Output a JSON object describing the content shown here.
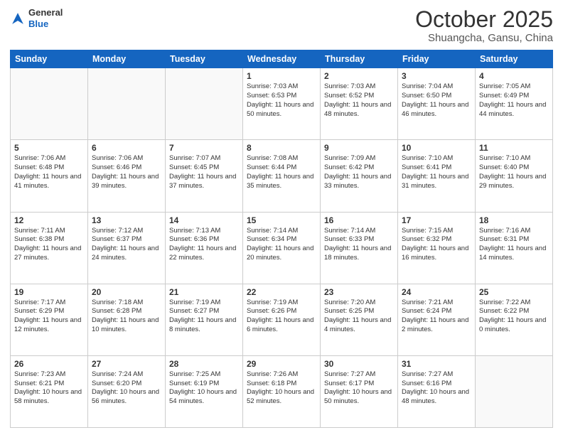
{
  "logo": {
    "line1": "General",
    "line2": "Blue"
  },
  "header": {
    "month": "October 2025",
    "location": "Shuangcha, Gansu, China"
  },
  "weekdays": [
    "Sunday",
    "Monday",
    "Tuesday",
    "Wednesday",
    "Thursday",
    "Friday",
    "Saturday"
  ],
  "weeks": [
    [
      {
        "day": "",
        "info": ""
      },
      {
        "day": "",
        "info": ""
      },
      {
        "day": "",
        "info": ""
      },
      {
        "day": "1",
        "info": "Sunrise: 7:03 AM\nSunset: 6:53 PM\nDaylight: 11 hours and 50 minutes."
      },
      {
        "day": "2",
        "info": "Sunrise: 7:03 AM\nSunset: 6:52 PM\nDaylight: 11 hours and 48 minutes."
      },
      {
        "day": "3",
        "info": "Sunrise: 7:04 AM\nSunset: 6:50 PM\nDaylight: 11 hours and 46 minutes."
      },
      {
        "day": "4",
        "info": "Sunrise: 7:05 AM\nSunset: 6:49 PM\nDaylight: 11 hours and 44 minutes."
      }
    ],
    [
      {
        "day": "5",
        "info": "Sunrise: 7:06 AM\nSunset: 6:48 PM\nDaylight: 11 hours and 41 minutes."
      },
      {
        "day": "6",
        "info": "Sunrise: 7:06 AM\nSunset: 6:46 PM\nDaylight: 11 hours and 39 minutes."
      },
      {
        "day": "7",
        "info": "Sunrise: 7:07 AM\nSunset: 6:45 PM\nDaylight: 11 hours and 37 minutes."
      },
      {
        "day": "8",
        "info": "Sunrise: 7:08 AM\nSunset: 6:44 PM\nDaylight: 11 hours and 35 minutes."
      },
      {
        "day": "9",
        "info": "Sunrise: 7:09 AM\nSunset: 6:42 PM\nDaylight: 11 hours and 33 minutes."
      },
      {
        "day": "10",
        "info": "Sunrise: 7:10 AM\nSunset: 6:41 PM\nDaylight: 11 hours and 31 minutes."
      },
      {
        "day": "11",
        "info": "Sunrise: 7:10 AM\nSunset: 6:40 PM\nDaylight: 11 hours and 29 minutes."
      }
    ],
    [
      {
        "day": "12",
        "info": "Sunrise: 7:11 AM\nSunset: 6:38 PM\nDaylight: 11 hours and 27 minutes."
      },
      {
        "day": "13",
        "info": "Sunrise: 7:12 AM\nSunset: 6:37 PM\nDaylight: 11 hours and 24 minutes."
      },
      {
        "day": "14",
        "info": "Sunrise: 7:13 AM\nSunset: 6:36 PM\nDaylight: 11 hours and 22 minutes."
      },
      {
        "day": "15",
        "info": "Sunrise: 7:14 AM\nSunset: 6:34 PM\nDaylight: 11 hours and 20 minutes."
      },
      {
        "day": "16",
        "info": "Sunrise: 7:14 AM\nSunset: 6:33 PM\nDaylight: 11 hours and 18 minutes."
      },
      {
        "day": "17",
        "info": "Sunrise: 7:15 AM\nSunset: 6:32 PM\nDaylight: 11 hours and 16 minutes."
      },
      {
        "day": "18",
        "info": "Sunrise: 7:16 AM\nSunset: 6:31 PM\nDaylight: 11 hours and 14 minutes."
      }
    ],
    [
      {
        "day": "19",
        "info": "Sunrise: 7:17 AM\nSunset: 6:29 PM\nDaylight: 11 hours and 12 minutes."
      },
      {
        "day": "20",
        "info": "Sunrise: 7:18 AM\nSunset: 6:28 PM\nDaylight: 11 hours and 10 minutes."
      },
      {
        "day": "21",
        "info": "Sunrise: 7:19 AM\nSunset: 6:27 PM\nDaylight: 11 hours and 8 minutes."
      },
      {
        "day": "22",
        "info": "Sunrise: 7:19 AM\nSunset: 6:26 PM\nDaylight: 11 hours and 6 minutes."
      },
      {
        "day": "23",
        "info": "Sunrise: 7:20 AM\nSunset: 6:25 PM\nDaylight: 11 hours and 4 minutes."
      },
      {
        "day": "24",
        "info": "Sunrise: 7:21 AM\nSunset: 6:24 PM\nDaylight: 11 hours and 2 minutes."
      },
      {
        "day": "25",
        "info": "Sunrise: 7:22 AM\nSunset: 6:22 PM\nDaylight: 11 hours and 0 minutes."
      }
    ],
    [
      {
        "day": "26",
        "info": "Sunrise: 7:23 AM\nSunset: 6:21 PM\nDaylight: 10 hours and 58 minutes."
      },
      {
        "day": "27",
        "info": "Sunrise: 7:24 AM\nSunset: 6:20 PM\nDaylight: 10 hours and 56 minutes."
      },
      {
        "day": "28",
        "info": "Sunrise: 7:25 AM\nSunset: 6:19 PM\nDaylight: 10 hours and 54 minutes."
      },
      {
        "day": "29",
        "info": "Sunrise: 7:26 AM\nSunset: 6:18 PM\nDaylight: 10 hours and 52 minutes."
      },
      {
        "day": "30",
        "info": "Sunrise: 7:27 AM\nSunset: 6:17 PM\nDaylight: 10 hours and 50 minutes."
      },
      {
        "day": "31",
        "info": "Sunrise: 7:27 AM\nSunset: 6:16 PM\nDaylight: 10 hours and 48 minutes."
      },
      {
        "day": "",
        "info": ""
      }
    ]
  ]
}
